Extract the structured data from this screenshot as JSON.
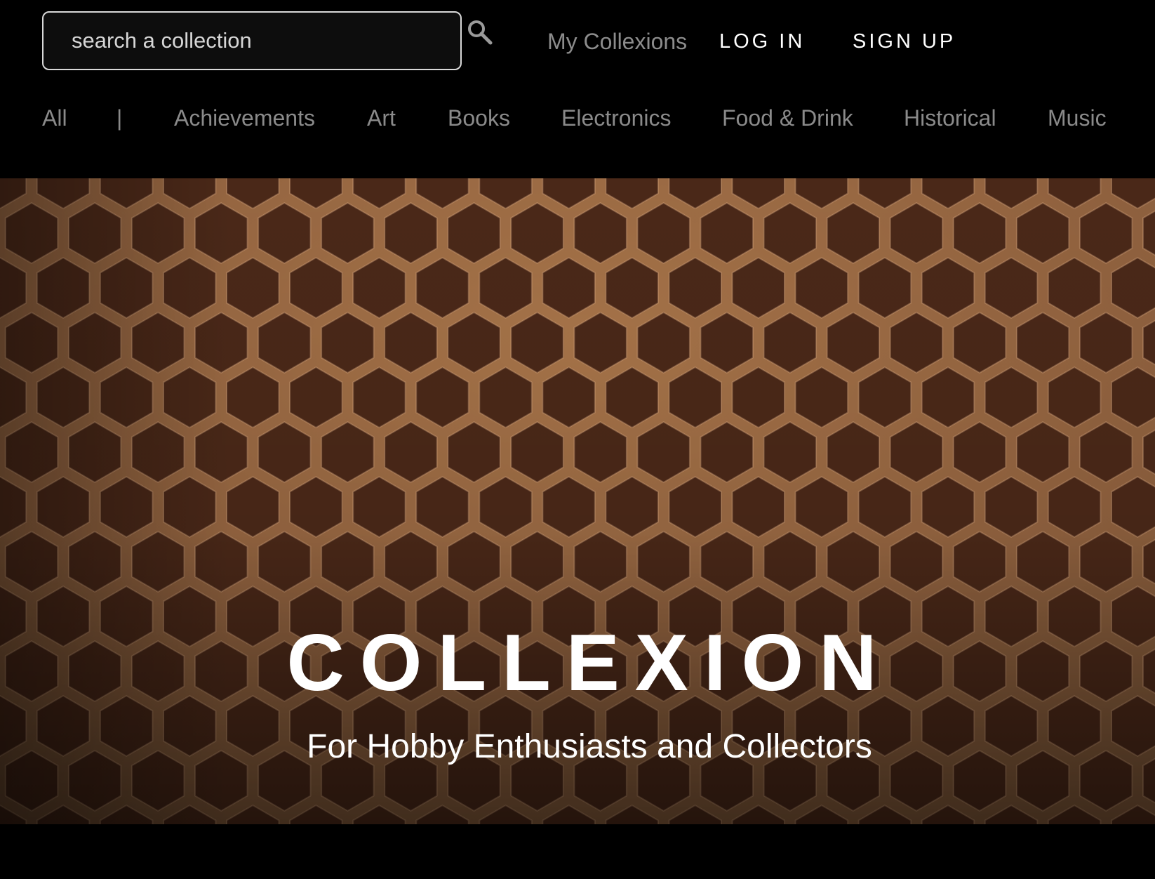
{
  "header": {
    "search": {
      "placeholder": "search a collection",
      "value": ""
    },
    "search_icon": "search-icon",
    "my_collexions_label": "My Collexions",
    "login_label": "LOG IN",
    "signup_label": "SIGN UP"
  },
  "categories": {
    "all": "All",
    "separator": "|",
    "items": [
      "Achievements",
      "Art",
      "Books",
      "Electronics",
      "Food & Drink",
      "Historical",
      "Music"
    ]
  },
  "hero": {
    "title": "COLLEXION",
    "subtitle": "For Hobby Enthusiasts and Collectors",
    "background_image": "honeycomb"
  },
  "colors": {
    "background": "#000000",
    "nav_text": "#8a8a8a",
    "primary_text": "#ffffff",
    "comb_wall": "#c08a5a",
    "comb_cell": "#4a2818"
  }
}
